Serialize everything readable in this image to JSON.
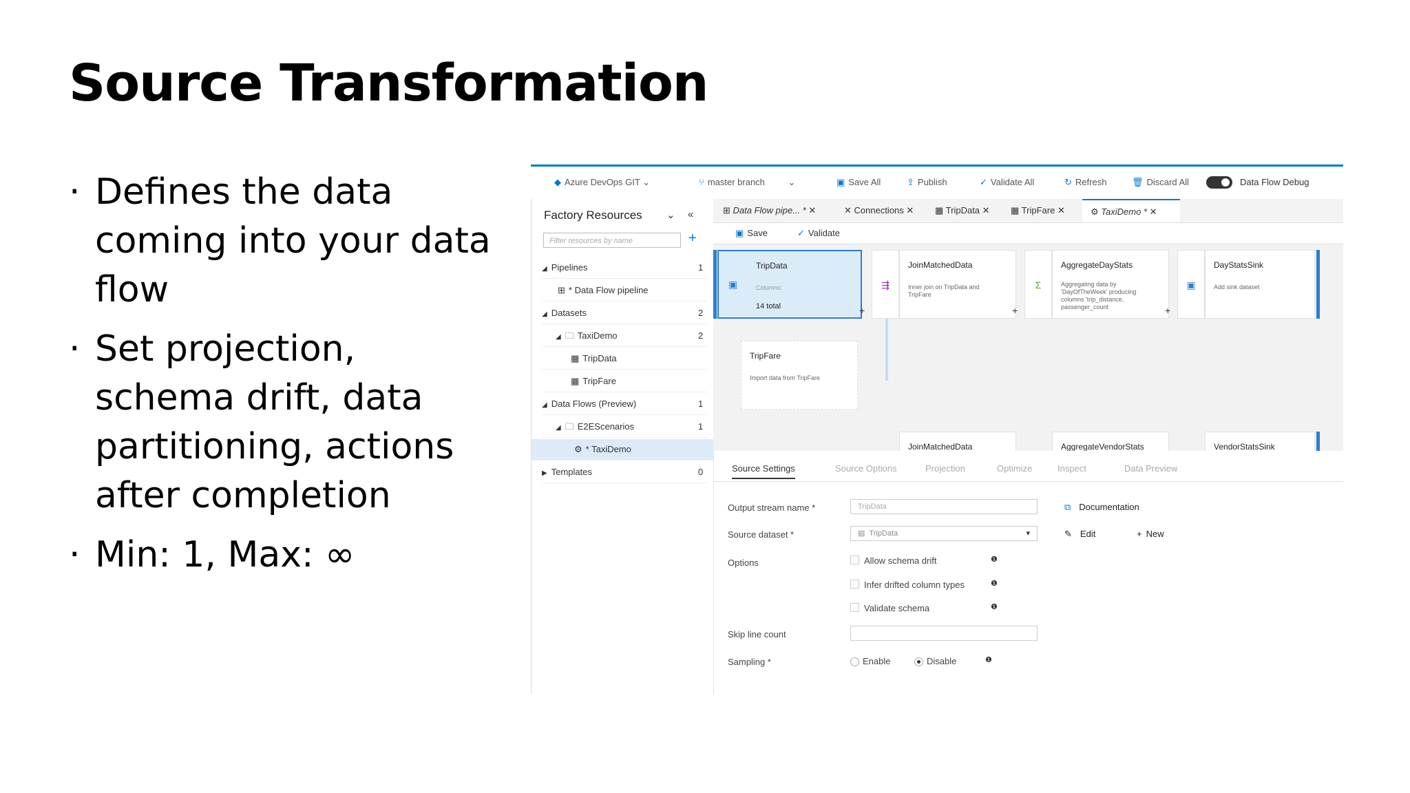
{
  "slide": {
    "title": "Source Transformation",
    "bullets": [
      "Defines the data coming into your data flow",
      "Set projection, schema drift, data partitioning, actions after completion",
      "Min: 1, Max: ∞"
    ],
    "bullet_marker": "·"
  },
  "ui": {
    "toolbar": {
      "repo": "Azure DevOps GIT",
      "branch": "master branch",
      "save_all": "Save All",
      "publish": "Publish",
      "validate_all": "Validate All",
      "refresh": "Refresh",
      "discard_all": "Discard All",
      "debug": "Data Flow Debug"
    },
    "sidebar": {
      "title": "Factory Resources",
      "search_placeholder": "Filter resources by name",
      "items": [
        {
          "label": "Pipelines",
          "count": "1"
        },
        {
          "label": "* Data Flow pipeline",
          "count": ""
        },
        {
          "label": "Datasets",
          "count": "2"
        },
        {
          "label": "TaxiDemo",
          "count": "2"
        },
        {
          "label": "TripData",
          "count": ""
        },
        {
          "label": "TripFare",
          "count": ""
        },
        {
          "label": "Data Flows (Preview)",
          "count": "1"
        },
        {
          "label": "E2EScenarios",
          "count": "1"
        },
        {
          "label": "* TaxiDemo",
          "count": ""
        },
        {
          "label": "Templates",
          "count": "0"
        }
      ]
    },
    "tabs": [
      "Data Flow pipe... *",
      "Connections",
      "TripData",
      "TripFare",
      "TaxiDemo *"
    ],
    "subtoolbar": {
      "save": "Save",
      "validate": "Validate"
    },
    "canvas": {
      "nodes": [
        {
          "name": "TripData",
          "desc": "Columns:",
          "total": "14 total"
        },
        {
          "name": "JoinMatchedData",
          "desc": "Inner join on TripData and\nTripFare"
        },
        {
          "name": "AggregateDayStats",
          "desc": "Aggregating data by\n'DayOfTheWeek' producing\ncolumns 'trip_distance,\npassenger_count"
        },
        {
          "name": "DayStatsSink",
          "desc": "Add sink dataset"
        },
        {
          "name": "TripFare",
          "desc": "Import data from TripFare"
        },
        {
          "name": "JoinMatchedData",
          "desc": ""
        },
        {
          "name": "AggregateVendorStats",
          "desc": ""
        },
        {
          "name": "VendorStatsSink",
          "desc": ""
        }
      ]
    },
    "panel": {
      "tabs": [
        "Source Settings",
        "Source Options",
        "Projection",
        "Optimize",
        "Inspect",
        "Data Preview"
      ],
      "output_stream_label": "Output stream name *",
      "output_stream_value": "TripData",
      "documentation": "Documentation",
      "source_dataset_label": "Source dataset *",
      "source_dataset_value": "TripData",
      "edit": "Edit",
      "new": "New",
      "options_label": "Options",
      "options": [
        "Allow schema drift",
        "Infer drifted column types",
        "Validate schema"
      ],
      "skip_line_label": "Skip line count",
      "sampling_label": "Sampling *",
      "sampling_enable": "Enable",
      "sampling_disable": "Disable"
    },
    "colors": {
      "accent": "#0078d4",
      "selected_node": "#dbecf9"
    }
  }
}
